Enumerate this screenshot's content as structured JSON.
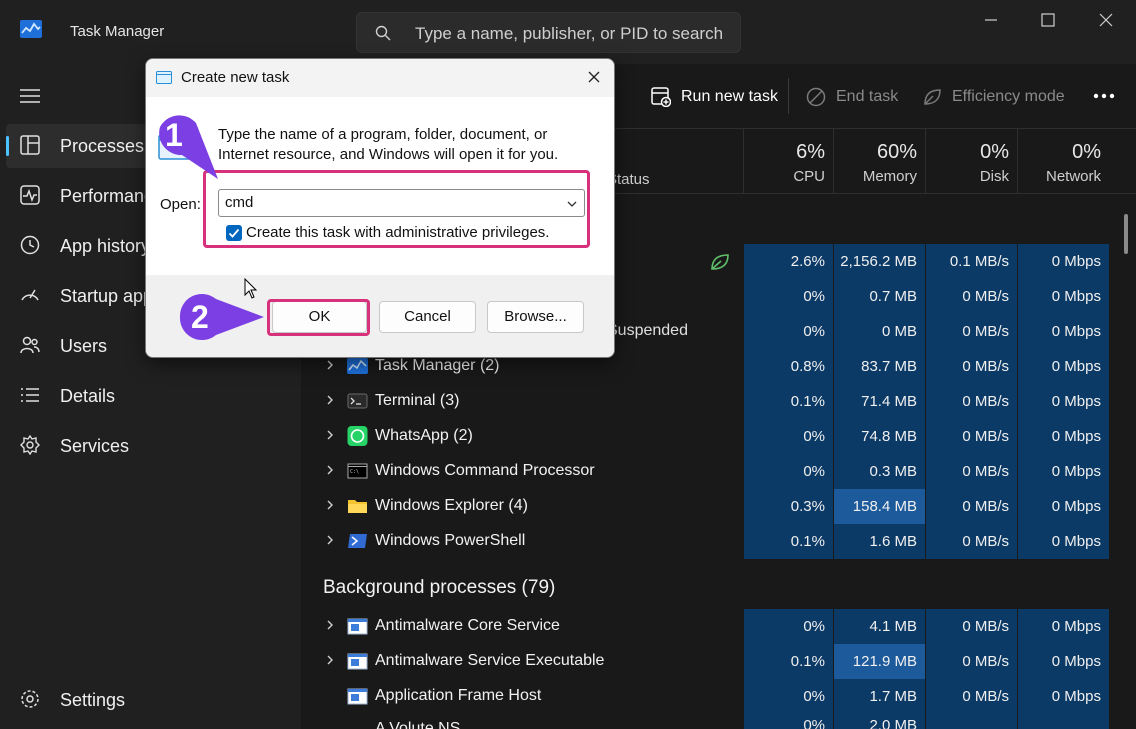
{
  "window": {
    "title": "Task Manager",
    "search_placeholder": "Type a name, publisher, or PID to search"
  },
  "sidebar": {
    "items": [
      {
        "label": "Processes",
        "icon": "processes-icon",
        "active": true
      },
      {
        "label": "Performance",
        "icon": "performance-icon"
      },
      {
        "label": "App history",
        "icon": "history-icon"
      },
      {
        "label": "Startup apps",
        "icon": "startup-icon"
      },
      {
        "label": "Users",
        "icon": "users-icon"
      },
      {
        "label": "Details",
        "icon": "details-icon"
      },
      {
        "label": "Services",
        "icon": "services-icon"
      }
    ],
    "settings": "Settings"
  },
  "toolbar": {
    "run_new_task": "Run new task",
    "end_task": "End task",
    "efficiency_mode": "Efficiency mode"
  },
  "columns": {
    "status": "Status",
    "cpu": {
      "pct": "6%",
      "label": "CPU"
    },
    "memory": {
      "pct": "60%",
      "label": "Memory"
    },
    "disk": {
      "pct": "0%",
      "label": "Disk"
    },
    "network": {
      "pct": "0%",
      "label": "Network"
    }
  },
  "top_rows": [
    {
      "cpu": "2.6%",
      "mem": "2,156.2 MB",
      "disk": "0.1 MB/s",
      "net": "0 Mbps",
      "status_icon": "efficiency-leaf-icon"
    },
    {
      "cpu": "0%",
      "mem": "0.7 MB",
      "disk": "0 MB/s",
      "net": "0 Mbps"
    },
    {
      "cpu": "0%",
      "mem": "0 MB",
      "disk": "0 MB/s",
      "net": "0 Mbps",
      "status": "Suspended"
    }
  ],
  "apps": [
    {
      "name": "Task Manager (2)",
      "icon": "task-manager-icon",
      "cpu": "0.8%",
      "mem": "83.7 MB",
      "disk": "0 MB/s",
      "net": "0 Mbps"
    },
    {
      "name": "Terminal (3)",
      "icon": "terminal-icon",
      "cpu": "0.1%",
      "mem": "71.4 MB",
      "disk": "0 MB/s",
      "net": "0 Mbps"
    },
    {
      "name": "WhatsApp (2)",
      "icon": "whatsapp-icon",
      "cpu": "0%",
      "mem": "74.8 MB",
      "disk": "0 MB/s",
      "net": "0 Mbps"
    },
    {
      "name": "Windows Command Processor",
      "icon": "cmd-icon",
      "cpu": "0%",
      "mem": "0.3 MB",
      "disk": "0 MB/s",
      "net": "0 Mbps"
    },
    {
      "name": "Windows Explorer (4)",
      "icon": "folder-icon",
      "cpu": "0.3%",
      "mem": "158.4 MB",
      "disk": "0 MB/s",
      "net": "0 Mbps",
      "mem_high": true
    },
    {
      "name": "Windows PowerShell",
      "icon": "powershell-icon",
      "cpu": "0.1%",
      "mem": "1.6 MB",
      "disk": "0 MB/s",
      "net": "0 Mbps"
    }
  ],
  "background_header": "Background processes (79)",
  "background": [
    {
      "name": "Antimalware Core Service",
      "icon": "service-icon",
      "cpu": "0%",
      "mem": "4.1 MB",
      "disk": "0 MB/s",
      "net": "0 Mbps",
      "expandable": true
    },
    {
      "name": "Antimalware Service Executable",
      "icon": "service-icon",
      "cpu": "0.1%",
      "mem": "121.9 MB",
      "disk": "0 MB/s",
      "net": "0 Mbps",
      "expandable": true,
      "mem_high": true
    },
    {
      "name": "Application Frame Host",
      "icon": "service-icon",
      "cpu": "0%",
      "mem": "1.7 MB",
      "disk": "0 MB/s",
      "net": "0 Mbps",
      "expandable": false
    }
  ],
  "partial_row": {
    "name": "A Volute NS",
    "cpu": "0%",
    "mem": "2.0 MB"
  },
  "dialog": {
    "title": "Create new task",
    "description": "Type the name of a program, folder, document, or Internet resource, and Windows will open it for you.",
    "open_label": "Open:",
    "open_value": "cmd",
    "admin_checkbox_label": "Create this task with administrative privileges.",
    "admin_checked": true,
    "ok": "OK",
    "cancel": "Cancel",
    "browse": "Browse..."
  },
  "callouts": {
    "step1": "1",
    "step2": "2"
  },
  "colors": {
    "accent": "#4cc2ff",
    "highlight": "#d6317a",
    "callout": "#7b3fe4",
    "cell": "#0c3a66",
    "cell_high": "#1d5a9b"
  }
}
